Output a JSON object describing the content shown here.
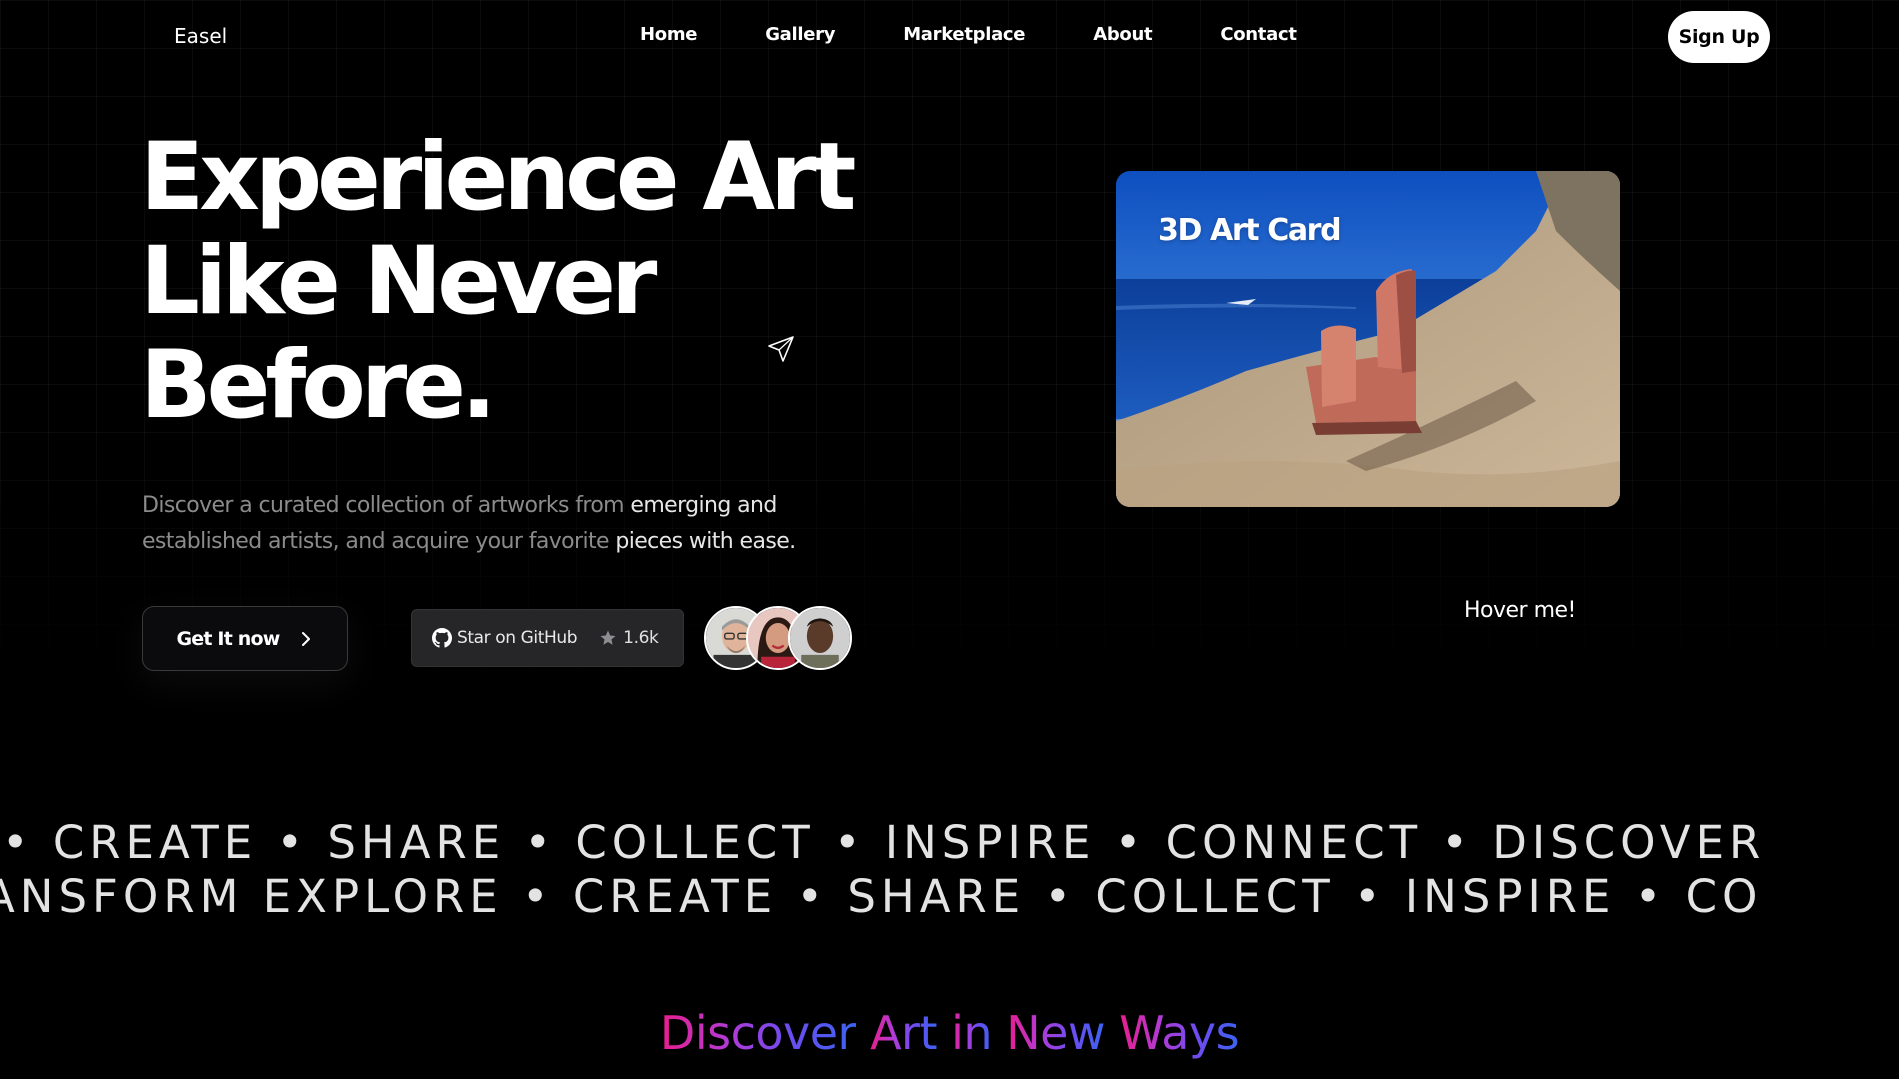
{
  "nav": {
    "logo": "Easel",
    "links": [
      "Home",
      "Gallery",
      "Marketplace",
      "About",
      "Contact"
    ],
    "signup_label": "Sign Up"
  },
  "hero": {
    "title_lines": [
      "Experience Art",
      "Like Never",
      "Before."
    ],
    "description_parts": [
      {
        "text": "Discover a curated collection of artworks from ",
        "highlight": false
      },
      {
        "text": "emerging and",
        "highlight": true
      },
      {
        "text": " established artists, and acquire your favorite ",
        "highlight": false
      },
      {
        "text": "pieces with ease.",
        "highlight": true
      }
    ],
    "cta_label": "Get It now",
    "github_label": "Star on GitHub",
    "github_count": "1.6k"
  },
  "card": {
    "title": "3D Art Card",
    "hover_hint": "Hover me!"
  },
  "marquee": {
    "row1": "• CREATE • SHARE • COLLECT • INSPIRE • CONNECT • DISCOVER",
    "row2": "ANSFORM EXPLORE • CREATE • SHARE • COLLECT • INSPIRE • CO"
  },
  "section": {
    "words": [
      "Discover",
      "Art",
      "in",
      "New",
      "Ways"
    ]
  },
  "colors": {
    "background": "#000000",
    "gradient_start": "#e91e8c",
    "gradient_end": "#3b63f2"
  },
  "icons": [
    "cursor-arrow-icon",
    "chevron-right-icon",
    "github-icon",
    "star-icon"
  ]
}
